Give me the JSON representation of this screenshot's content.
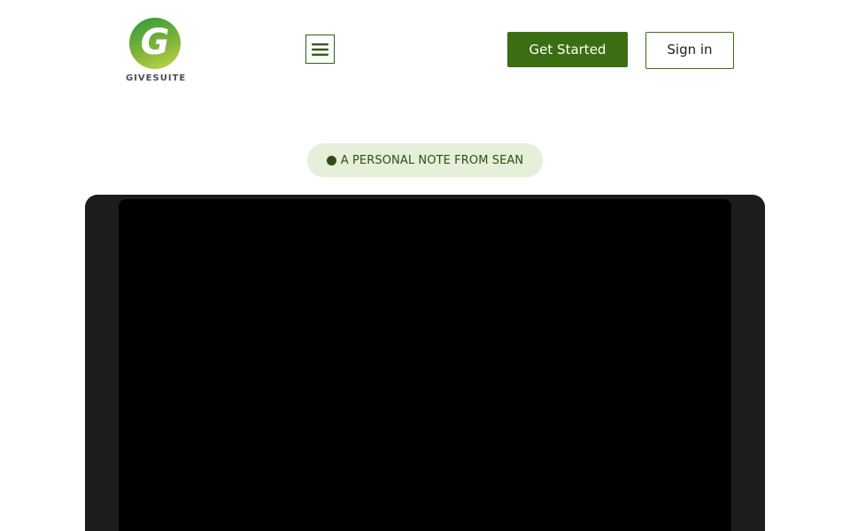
{
  "brand": {
    "logo_letter": "G",
    "name": "GIVESUITE"
  },
  "header": {
    "menu_icon": "hamburger-icon",
    "get_started_label": "Get Started",
    "sign_in_label": "Sign in"
  },
  "hero": {
    "pill_text": "A PERSONAL NOTE FROM SEAN"
  },
  "colors": {
    "primary": "#3b6e12",
    "pill_bg": "#e6efd9",
    "pill_text": "#2f4d17",
    "video_frame": "#1c1c1c",
    "video_screen": "#000000"
  }
}
